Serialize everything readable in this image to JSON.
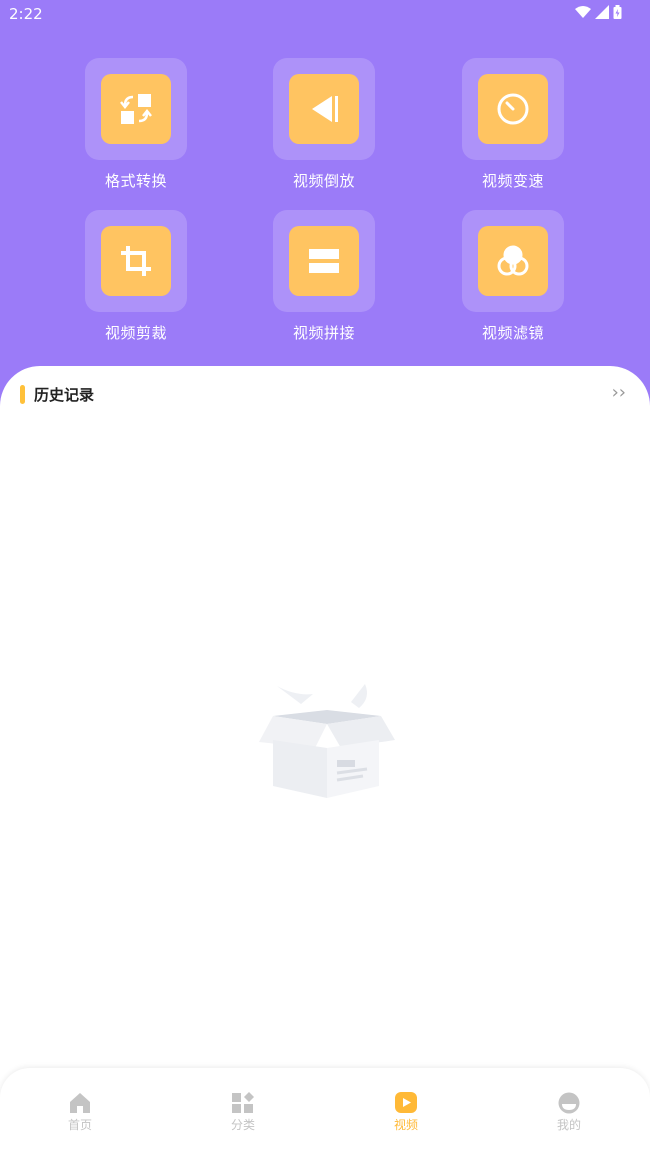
{
  "status_bar": {
    "time": "2:22"
  },
  "tools": [
    {
      "label": "格式转换",
      "icon": "format-convert-icon"
    },
    {
      "label": "视频倒放",
      "icon": "reverse-play-icon"
    },
    {
      "label": "视频变速",
      "icon": "speed-gauge-icon"
    },
    {
      "label": "视频剪裁",
      "icon": "crop-icon"
    },
    {
      "label": "视频拼接",
      "icon": "merge-icon"
    },
    {
      "label": "视频滤镜",
      "icon": "filter-icon"
    }
  ],
  "history": {
    "title": "历史记录",
    "more": "››"
  },
  "tabbar": {
    "items": [
      {
        "label": "首页",
        "icon": "home-icon"
      },
      {
        "label": "分类",
        "icon": "category-icon"
      },
      {
        "label": "视频",
        "icon": "video-play-icon"
      },
      {
        "label": "我的",
        "icon": "profile-icon"
      }
    ],
    "active_index": 2
  },
  "colors": {
    "background": "#9b7bf8",
    "tile_inner": "#ffc461",
    "accent": "#ffb937",
    "inactive_tab": "#c4c4c4"
  }
}
